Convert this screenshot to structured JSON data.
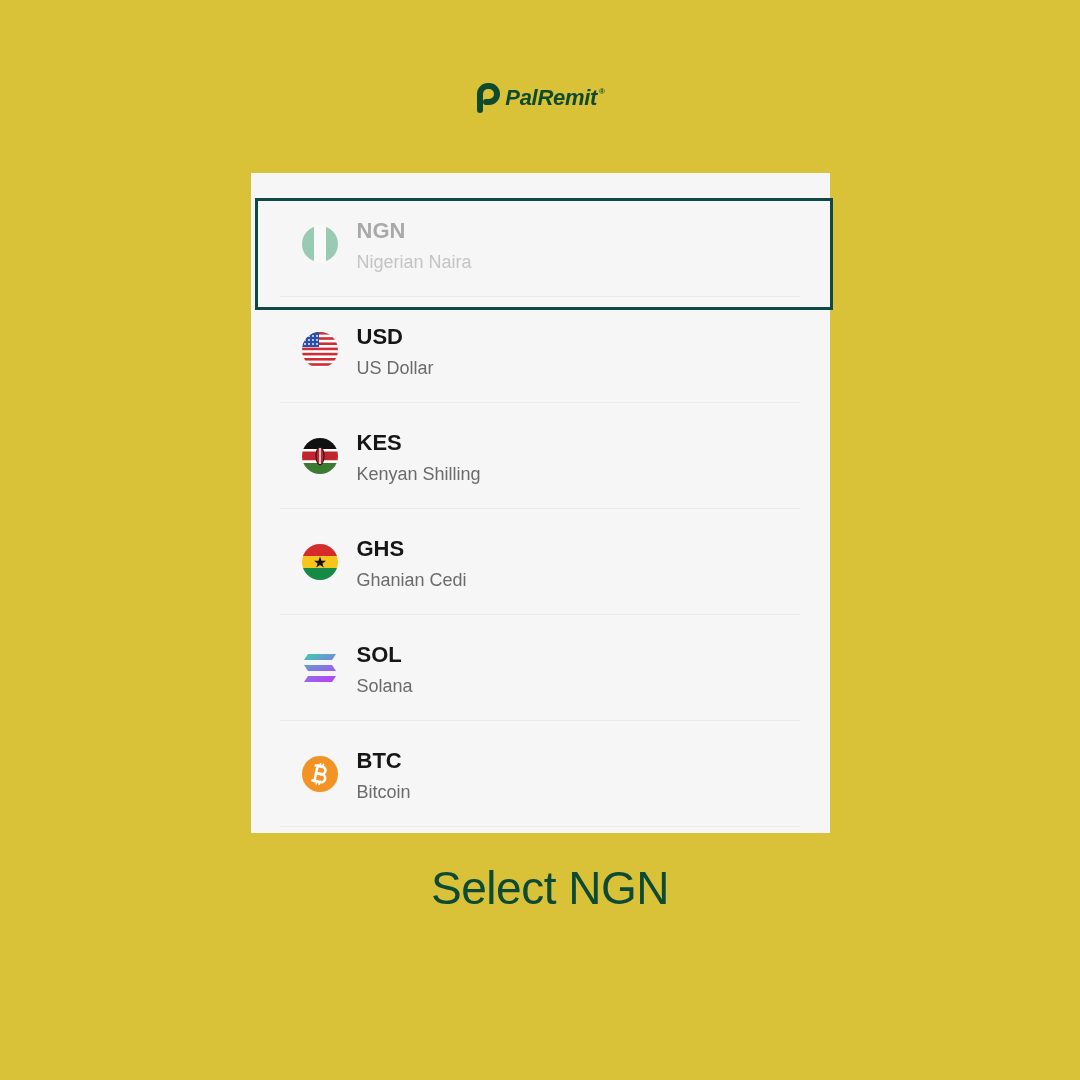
{
  "logo": {
    "text": "PalRemit$^{®}$"
  },
  "currencies": [
    {
      "code": "NGN",
      "name": "Nigerian Naira",
      "selected": true,
      "disabled": true
    },
    {
      "code": "USD",
      "name": "US Dollar",
      "selected": false,
      "disabled": false
    },
    {
      "code": "KES",
      "name": "Kenyan Shilling",
      "selected": false,
      "disabled": false
    },
    {
      "code": "GHS",
      "name": "Ghanian Cedi",
      "selected": false,
      "disabled": false
    },
    {
      "code": "SOL",
      "name": "Solana",
      "selected": false,
      "disabled": false
    },
    {
      "code": "BTC",
      "name": "Bitcoin",
      "selected": false,
      "disabled": false
    }
  ],
  "caption": "Select NGN"
}
